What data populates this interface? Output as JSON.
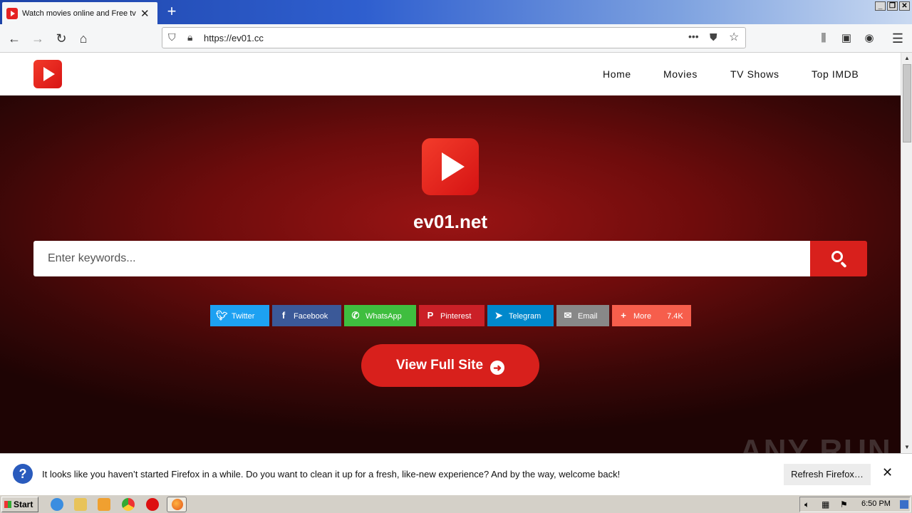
{
  "browser": {
    "tab_title": "Watch movies online and Free tv s",
    "tab_close": "✕",
    "new_tab": "+",
    "url": "https://ev01.cc",
    "page_actions": "•••",
    "window_buttons": [
      "_",
      "❐",
      "✕"
    ]
  },
  "site": {
    "menu": [
      "Home",
      "Movies",
      "TV Shows",
      "Top IMDB"
    ],
    "name": "ev01.net",
    "search_placeholder": "Enter keywords...",
    "share_buttons": [
      {
        "label": "Twitter",
        "icon": "twitter-icon",
        "color": "#1da1f2"
      },
      {
        "label": "Facebook",
        "icon": "facebook-icon",
        "color": "#3b5998"
      },
      {
        "label": "WhatsApp",
        "icon": "whatsapp-icon",
        "color": "#3fbe3f"
      },
      {
        "label": "Pinterest",
        "icon": "pinterest-icon",
        "color": "#cb2027"
      },
      {
        "label": "Telegram",
        "icon": "telegram-icon",
        "color": "#0088cc"
      },
      {
        "label": "Email",
        "icon": "email-icon",
        "color": "#888888"
      },
      {
        "label": "More",
        "icon": "plus-icon",
        "color": "#f65e4c",
        "count": "7.4K"
      }
    ],
    "view_full_label": "View Full Site",
    "accent": "#d8201c"
  },
  "notification": {
    "message": "It looks like you haven’t started Firefox in a while. Do you want to clean it up for a fresh, like-new experience? And by the way, welcome back!",
    "button": "Refresh Firefox…",
    "close": "✕"
  },
  "watermark": "ANY RUN",
  "taskbar": {
    "start": "Start",
    "clock": "6:50 PM"
  }
}
